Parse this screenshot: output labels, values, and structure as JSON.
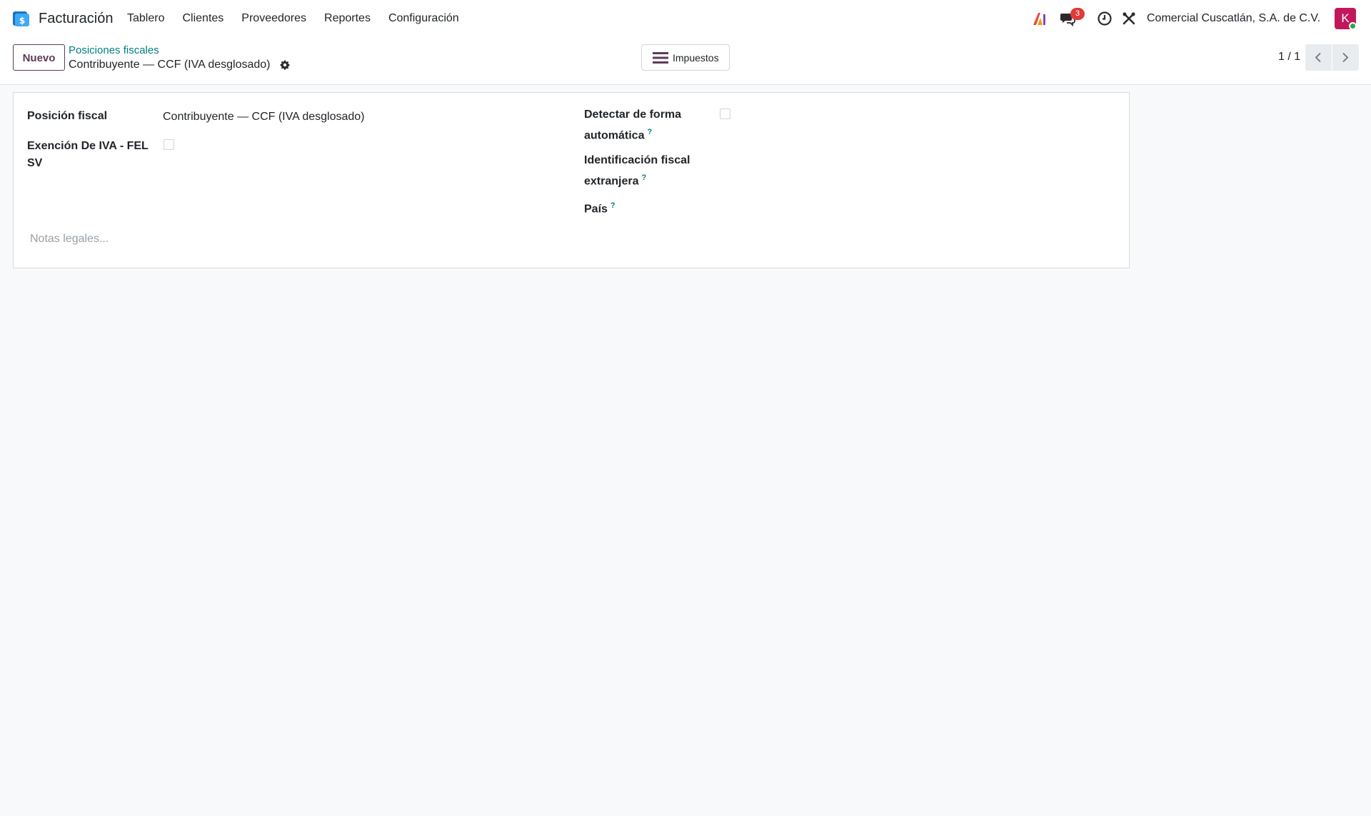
{
  "navbar": {
    "app_name": "Facturación",
    "menu": [
      "Tablero",
      "Clientes",
      "Proveedores",
      "Reportes",
      "Configuración"
    ],
    "messages_badge": "3",
    "company": "Comercial Cuscatlán, S.A. de C.V.",
    "avatar_letter": "K",
    "icons": [
      "app-logo-icon",
      "ai-icon",
      "chat-icon",
      "clock-icon",
      "tools-icon"
    ]
  },
  "control": {
    "new_label": "Nuevo",
    "breadcrumb_parent": "Posiciones fiscales",
    "breadcrumb_current": "Contribuyente — CCF (IVA desglosado)",
    "taxes_button": "Impuestos",
    "pager": "1 / 1"
  },
  "form": {
    "fiscal_position_label": "Posición fiscal",
    "fiscal_position_value": "Contribuyente — CCF (IVA desglosado)",
    "exemption_label_line1": "Exención De IVA - FEL",
    "exemption_label_line2": "SV",
    "exemption_checked": false,
    "auto_detect_label_line1": "Detectar de forma",
    "auto_detect_label_line2": "automática",
    "auto_detect_checked": false,
    "foreign_vat_label_line1": "Identificación fiscal",
    "foreign_vat_label_line2": "extranjera",
    "country_label": "País",
    "help_mark": "?",
    "notes_placeholder": "Notas legales..."
  },
  "colors": {
    "brand": "#5d3a58",
    "link": "#017e84",
    "badge": "#e03a3a",
    "avatar": "#c2185b"
  }
}
